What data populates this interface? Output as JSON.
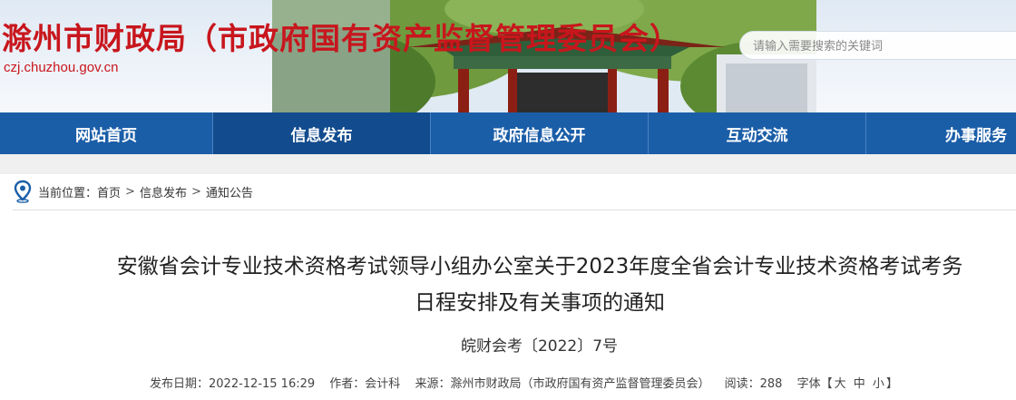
{
  "header": {
    "site_title": "滁州市财政局（市政府国有资产监督管理委员会）",
    "site_domain": "czj.chuzhou.gov.cn",
    "search_placeholder": "请输入需要搜索的关键词",
    "brand_color": "#c8161d"
  },
  "nav": {
    "items": [
      "网站首页",
      "信息发布",
      "政府信息公开",
      "互动交流",
      "办事服务"
    ],
    "active": "信息发布",
    "color": "#1b5ea8"
  },
  "breadcrumb": {
    "prefix": "当前位置：",
    "items": [
      "首页",
      "信息发布",
      "通知公告"
    ],
    "separator": ">"
  },
  "article": {
    "title_line1": "安徽省会计专业技术资格考试领导小组办公室关于2023年度全省会计专业技术资格考试考务",
    "title_line2": "日程安排及有关事项的通知",
    "doc_number": "皖财会考〔2022〕7号",
    "meta": {
      "publish_date": "发布日期：2022-12-15 16:29",
      "author": "作者：会计科",
      "source": "来源：滁州市财政局（市政府国有资产监督管理委员会）",
      "views": "阅读：288",
      "font_label": "字体【",
      "font_large": "大",
      "font_medium": "中",
      "font_small": "小",
      "font_close": "】"
    }
  }
}
